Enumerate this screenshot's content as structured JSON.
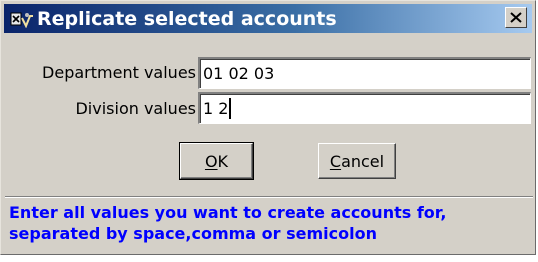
{
  "window": {
    "title": "Replicate selected accounts",
    "close_glyph": "✕"
  },
  "fields": {
    "department_label": "Department values",
    "department_value": "01 02 03",
    "division_label": "Division values",
    "division_value": "1 2"
  },
  "buttons": {
    "ok_mnemonic": "O",
    "ok_rest": "K",
    "cancel_mnemonic": "C",
    "cancel_rest": "ancel"
  },
  "hint": {
    "line1": "Enter all values you want to create accounts for,",
    "line2": "separated by space,comma or semicolon"
  },
  "colors": {
    "title_gradient_start": "#0a246a",
    "title_gradient_end": "#a6caf0",
    "dialog_face": "#d4d0c8",
    "hint_text": "#0000ff"
  },
  "icons": {
    "app": "app-icon",
    "close": "close-icon"
  }
}
